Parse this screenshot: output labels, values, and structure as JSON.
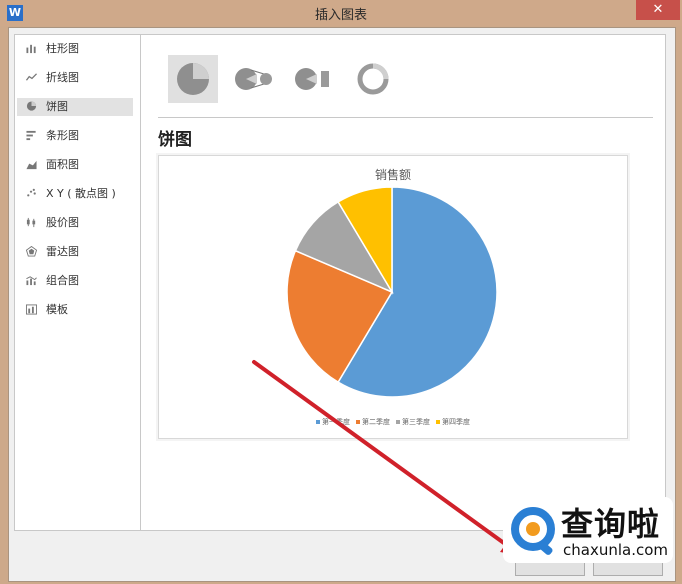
{
  "window": {
    "title": "插入图表",
    "app_icon": "W",
    "close_glyph": "✕"
  },
  "sidebar": {
    "items": [
      {
        "label": "柱形图",
        "icon": "column-chart-icon"
      },
      {
        "label": "折线图",
        "icon": "line-chart-icon"
      },
      {
        "label": "饼图",
        "icon": "pie-chart-icon",
        "selected": true
      },
      {
        "label": "条形图",
        "icon": "bar-chart-icon"
      },
      {
        "label": "面积图",
        "icon": "area-chart-icon"
      },
      {
        "label": "X Y ( 散点图 )",
        "icon": "scatter-chart-icon"
      },
      {
        "label": "股价图",
        "icon": "stock-chart-icon"
      },
      {
        "label": "雷达图",
        "icon": "radar-chart-icon"
      },
      {
        "label": "组合图",
        "icon": "combo-chart-icon"
      },
      {
        "label": "模板",
        "icon": "template-icon"
      }
    ]
  },
  "main": {
    "subtypes": [
      "pie",
      "pie-of-pie",
      "bar-of-pie",
      "doughnut"
    ],
    "section_title": "饼图"
  },
  "chart_data": {
    "type": "pie",
    "title": "销售额",
    "categories": [
      "第一季度",
      "第二季度",
      "第三季度",
      "第四季度"
    ],
    "values": [
      8.2,
      3.2,
      1.4,
      1.2
    ],
    "colors": [
      "#5b9bd5",
      "#ed7d31",
      "#a5a5a5",
      "#ffc000"
    ],
    "legend_position": "bottom"
  },
  "watermark": {
    "cn": "查询啦",
    "en": "chaxunla.com",
    "color": "#2a7fd4"
  },
  "annotation": {
    "arrow_color": "#d0212a"
  }
}
